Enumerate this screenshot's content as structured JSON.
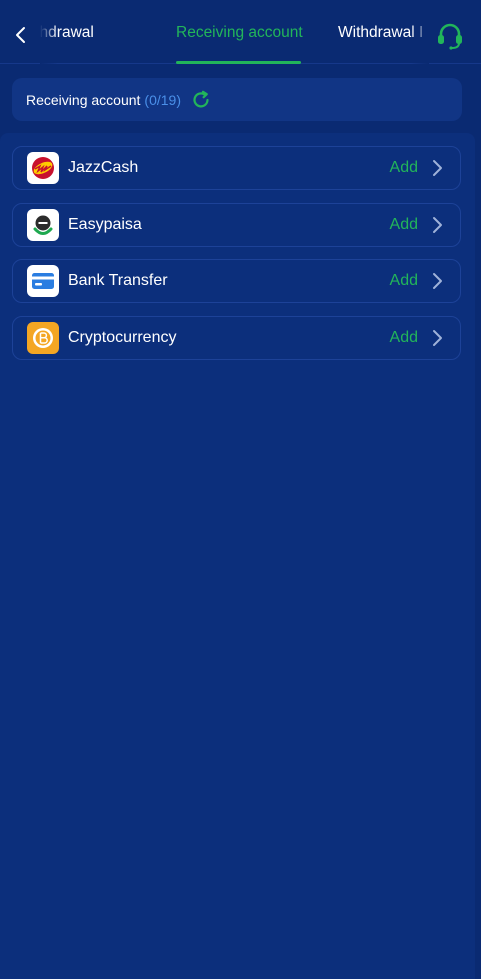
{
  "header": {
    "tabs": [
      {
        "label": "t withdrawal"
      },
      {
        "label": "Receiving account"
      },
      {
        "label": "Withdrawal I"
      }
    ]
  },
  "summary": {
    "label": "Receiving account",
    "count": "(0/19)"
  },
  "accounts": [
    {
      "name": "JazzCash",
      "action": "Add",
      "icon": "jazzcash-logo"
    },
    {
      "name": "Easypaisa",
      "action": "Add",
      "icon": "easypaisa-logo"
    },
    {
      "name": "Bank Transfer",
      "action": "Add",
      "icon": "bank-card-icon"
    },
    {
      "name": "Cryptocurrency",
      "action": "Add",
      "icon": "bitcoin-icon"
    }
  ],
  "colors": {
    "background": "#0a2a72",
    "accent": "#22b55a",
    "count": "#4a8fe8"
  }
}
